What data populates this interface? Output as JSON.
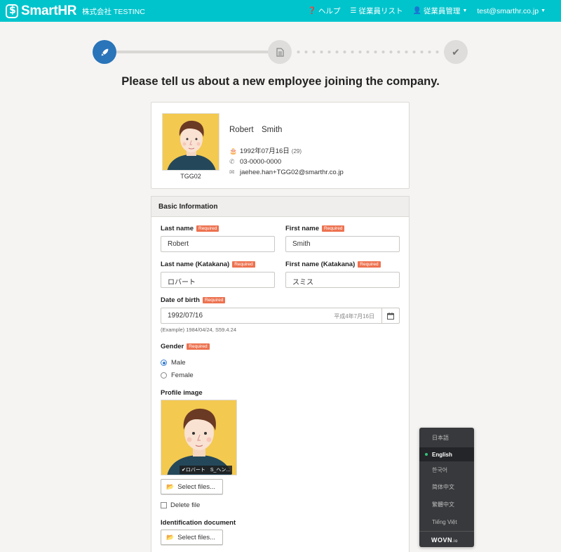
{
  "header": {
    "logo_text": "SmartHR",
    "company": "株式会社 TESTINC",
    "nav": {
      "help": "ヘルプ",
      "employee_list": "従業員リスト",
      "employee_management": "従業員管理",
      "user_email": "test@smarthr.co.jp"
    }
  },
  "stepper": {
    "current_step": 1,
    "total_steps": 3
  },
  "headline": "Please tell us about a new employee joining the company.",
  "employee_card": {
    "code": "TGG02",
    "name": "Robert　Smith",
    "birth": "1992年07月16日",
    "age": "(29)",
    "phone": "03-0000-0000",
    "email": "jaehee.han+TGG02@smarthr.co.jp"
  },
  "form": {
    "section_title": "Basic Information",
    "required_badge": "Required",
    "last_name_label": "Last name",
    "last_name_value": "Robert",
    "first_name_label": "First name",
    "first_name_value": "Smith",
    "last_name_kana_label": "Last name (Katakana)",
    "last_name_kana_value": "ロバート",
    "first_name_kana_label": "First name (Katakana)",
    "first_name_kana_value": "スミス",
    "dob_label": "Date of birth",
    "dob_value": "1992/07/16",
    "dob_hint": "平成4年7月16日",
    "dob_example": "(Example) 1984/04/24, S59.4.24",
    "gender_label": "Gender",
    "gender_male": "Male",
    "gender_female": "Female",
    "gender_selected": "Male",
    "profile_image_label": "Profile image",
    "profile_file_name": "✔ロバート　S_ヘン...",
    "select_files": "Select files...",
    "delete_file": "Delete file",
    "id_doc_label": "Identification document",
    "select_files_2": "Select files..."
  },
  "language_switcher": {
    "languages": [
      "日本語",
      "English",
      "한국어",
      "简体中文",
      "繁體中文",
      "Tiếng Việt"
    ],
    "selected": "English",
    "brand": "WOVN",
    "brand_suffix": ".io"
  }
}
